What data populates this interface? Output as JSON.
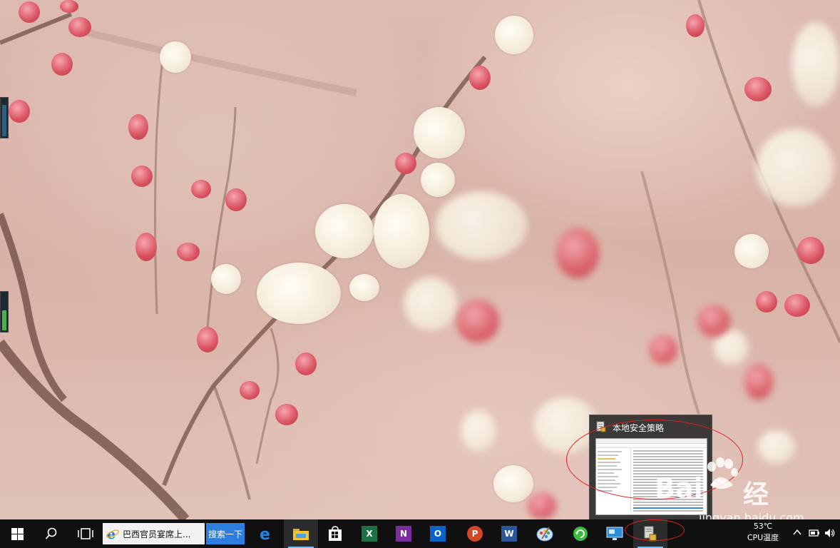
{
  "thumbnail_preview": {
    "title": "本地安全策略",
    "icon": "policy-shield-icon"
  },
  "watermark": {
    "logo_text": "Bai",
    "paw_icon": "baidu-paw-icon",
    "chinese_text": "经验",
    "url": "jingyan.baidu.com"
  },
  "taskbar": {
    "start_icon": "windows-start-icon",
    "search_icon": "search-icon",
    "task_view_icon": "task-view-icon",
    "search_box": {
      "icon": "ie-icon",
      "text": "巴西官员宴席上...",
      "button_label": "搜索一下"
    },
    "apps": [
      {
        "name": "edge",
        "icon": "edge-icon",
        "color": "#1e88e5"
      },
      {
        "name": "file-explorer",
        "icon": "folder-icon",
        "color": "#f4c430"
      },
      {
        "name": "store",
        "icon": "store-icon",
        "color": "#ffffff"
      },
      {
        "name": "excel",
        "icon": "excel-icon",
        "color": "#1e7145",
        "letter": "X"
      },
      {
        "name": "onenote",
        "icon": "onenote-icon",
        "color": "#7b2c9e",
        "letter": "N"
      },
      {
        "name": "outlook",
        "icon": "outlook-icon",
        "color": "#0a64c8",
        "letter": "O"
      },
      {
        "name": "powerpoint",
        "icon": "powerpoint-icon",
        "color": "#d24726",
        "letter": "P"
      },
      {
        "name": "word",
        "icon": "word-icon",
        "color": "#2b579a",
        "letter": "W"
      },
      {
        "name": "paint",
        "icon": "paint-palette-icon",
        "color": "#5aa0e0"
      },
      {
        "name": "update",
        "icon": "green-refresh-icon",
        "color": "#3dbb3d"
      },
      {
        "name": "remote-desktop",
        "icon": "monitor-icon",
        "color": "#2b8cd8"
      },
      {
        "name": "local-security-policy",
        "icon": "policy-shield-icon",
        "color": "#8a8a8a"
      }
    ],
    "tray": {
      "temperature": "53℃",
      "temperature_label": "CPU温度",
      "up_arrow_icon": "chevron-up-icon",
      "battery_icon": "battery-icon",
      "volume_icon": "speaker-icon"
    }
  }
}
